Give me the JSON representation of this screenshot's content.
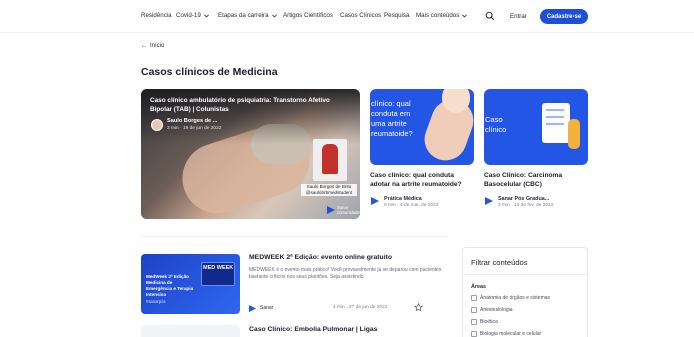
{
  "nav": {
    "items": [
      "Residência",
      "Covid-19",
      "Etapas da carreira",
      "Artigos Científicos",
      "Casos Clínicos",
      "Pesquisa",
      "Mais conteúdos"
    ],
    "login": "Entrar",
    "cta": "Cadastre-se"
  },
  "breadcrumb": {
    "back": "Início"
  },
  "page": {
    "title": "Casos clínicos de Medicina"
  },
  "featured": {
    "title": "Caso clínico ambulatório de psiquiatria: Transtorno Afetivo Bipolar (TAB) | Colunistas",
    "author": "Saulo Borges de ...",
    "meta": "3 min  ·  19 de jun de 2022",
    "badge_text": "Saulo Borges de Brito @saulobrbmedstudent",
    "brand": "Sanar comunidade"
  },
  "cards": [
    {
      "image_text": "clínico: qual conduta em uma artrite reumatoide?",
      "title": "Caso clínico: qual conduta adotar na artrite reumatoide?",
      "author": "Prática Médica",
      "meta": "9 min  ·  4 de mai. de 2022"
    },
    {
      "image_text": "Caso clínico",
      "title": "Caso Clínico: Carcinoma Basocelular (CBC)",
      "author": "Sanar Pós Gradua...",
      "meta": "3 min  ·  13 de fev. de 2022"
    }
  ],
  "posts": [
    {
      "thumb_title": "MedWeek 2ª Edição Medicina de Emergência e Terapia Intensiva",
      "thumb_tag": "#sanarpós",
      "screen_text": "MED WEEK",
      "title": "MEDWEEK 2ª Edição: evento online gratuito",
      "excerpt": "MEDWEEK é o evento mais prático! Você provavelmente já se deparou com pacientes bastante críticos nos seus plantões. Seja assistindo.",
      "author": "Sanar",
      "meta": "4 min  ·  27 de jun de 2021"
    },
    {
      "title": "Caso Clínico: Embolia Pulmonar | Ligas"
    }
  ],
  "filter": {
    "title": "Filtrar conteúdos",
    "section": "Áreas",
    "options": [
      "Anatomia de órgãos e sistemas",
      "Anestesiologia",
      "Bioética",
      "Biologia molecular e celular"
    ]
  },
  "colors": {
    "brand_blue": "#1f4fd6",
    "card_blue": "#2456e5"
  }
}
